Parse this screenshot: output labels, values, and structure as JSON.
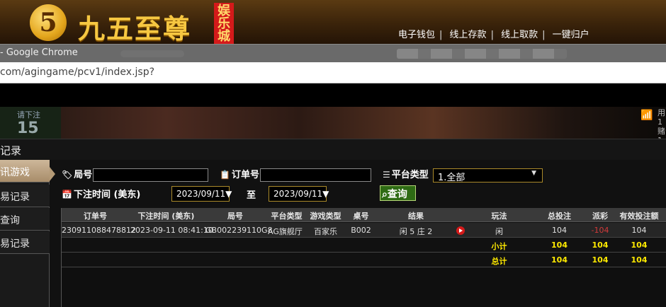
{
  "banner": {
    "logo_char": "5",
    "brand": "九五至尊",
    "badge": "娱乐城",
    "nav": [
      "电子钱包",
      "线上存款",
      "线上取款",
      "一键归户"
    ]
  },
  "browser": {
    "title": "- Google Chrome",
    "url": "com/agingame/pcv1/index.jsp?"
  },
  "game": {
    "bet_label": "请下注",
    "countdown": "15",
    "right_text": "用 1 赌 1"
  },
  "section_title": "记录",
  "sidebar": {
    "items": [
      {
        "label": "讯游戏"
      },
      {
        "label": "易记录"
      },
      {
        "label": "查询"
      },
      {
        "label": "易记录"
      }
    ]
  },
  "filters": {
    "round_label": "局号",
    "order_label": "订单号",
    "platform_label": "平台类型",
    "platform_value": "1.全部",
    "time_label": "下注时间 (美东)",
    "date_from": "2023/09/11▼",
    "to_label": "至",
    "date_to": "2023/09/11▼",
    "query_label": "查询"
  },
  "table": {
    "headers": [
      "订单号",
      "下注时间 (美东)",
      "局号",
      "平台类型",
      "游戏类型",
      "桌号",
      "结果",
      "玩法",
      "总投注",
      "派彩",
      "有效投注额"
    ],
    "rows": [
      {
        "order": "230911088478812",
        "time": "2023-09-11 08:41:10",
        "round": "GB002239110G8",
        "platform": "AG旗舰厅",
        "game": "百家乐",
        "table": "B002",
        "result": "闲 5 庄 2",
        "play": "闲",
        "total_bet": "104",
        "payout": "-104",
        "valid_bet": "104"
      }
    ],
    "subtotal": {
      "label": "小计",
      "total_bet": "104",
      "payout": "104",
      "valid_bet": "104"
    },
    "total": {
      "label": "总计",
      "total_bet": "104",
      "payout": "104",
      "valid_bet": "104"
    }
  }
}
